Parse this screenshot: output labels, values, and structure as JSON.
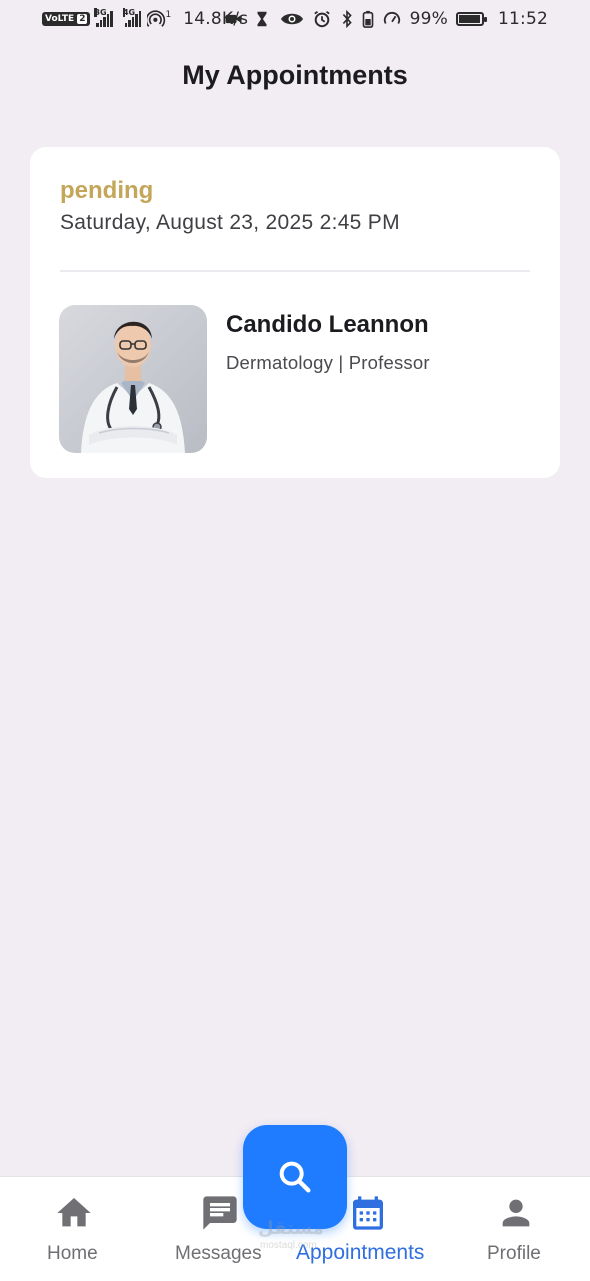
{
  "status_bar": {
    "volte": "VoLTE",
    "sim": "2",
    "net1": "3G",
    "net2": "4G",
    "hotspot_count": "1",
    "speed": "14.8K/s",
    "battery": "99%",
    "time": "11:52"
  },
  "header": {
    "title": "My Appointments"
  },
  "appointment": {
    "status": "pending",
    "status_color": "#c3a65a",
    "datetime": "Saturday, August 23, 2025 2:45 PM",
    "doctor": {
      "name": "Candido Leannon",
      "specialty_title": "Dermatology | Professor"
    }
  },
  "fab": {
    "icon": "search-icon",
    "color": "#1f7cff"
  },
  "bottom_nav": {
    "items": [
      {
        "label": "Home",
        "icon": "home-icon",
        "active": false
      },
      {
        "label": "Messages",
        "icon": "message-icon",
        "active": false
      },
      {
        "label": "Appointments",
        "icon": "calendar-icon",
        "active": true
      },
      {
        "label": "Profile",
        "icon": "person-icon",
        "active": false
      }
    ],
    "active_color": "#2f6fe0"
  },
  "watermark": {
    "text_ar": "مستقل",
    "text_en": "mostaql.com"
  }
}
